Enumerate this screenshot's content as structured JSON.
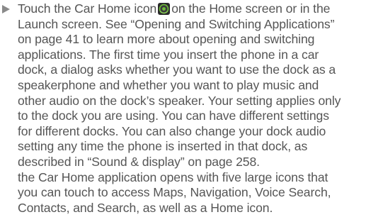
{
  "instructions": {
    "step_line_1_before_icon": "Touch the Car Home icon",
    "step_line_1_after_icon": "on the Home screen or in the",
    "step_line_2": "Launch screen. See “Opening and Switching Applications”",
    "step_line_3": "on page 41 to learn more about opening and switching",
    "step_line_4": "applications. The first time you insert the phone in a car",
    "step_line_5": "dock, a dialog asks whether you want to use the dock as a",
    "step_line_6": "speakerphone and whether you want to play music and",
    "step_line_7": "other audio on the dock’s speaker. Your setting applies only",
    "step_line_8": "to the dock you are using. You can have different settings",
    "step_line_9": "for different docks. You can also change your dock audio",
    "step_line_10": "setting any time the phone is inserted in that dock, as",
    "step_line_11": "described in “Sound & display” on page 258.",
    "result_line_1": "the Car Home application opens with five large icons that",
    "result_line_2": "you can touch to access Maps, Navigation, Voice Search,",
    "result_line_3": "Contacts, and Search, as well as a Home icon.",
    "bullet_icon": "right-triangle-bullet-icon",
    "inline_icon": "car-home-app-icon"
  },
  "colors": {
    "text": "#555555",
    "bullet": "#8a8a8a",
    "icon_dark": "#2b2b2b",
    "icon_green": "#6fbf3a"
  }
}
